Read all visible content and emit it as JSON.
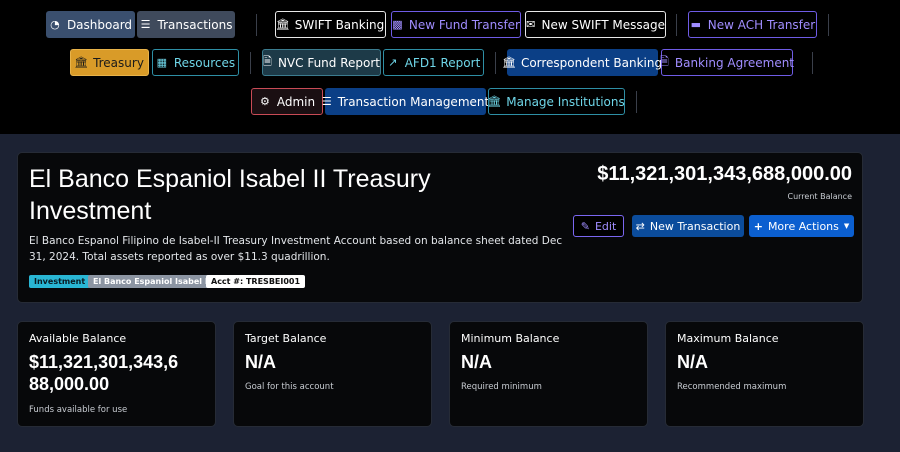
{
  "nav": {
    "row1": [
      {
        "label": "Dashboard",
        "icon": "dashboard-icon"
      },
      {
        "label": "Transactions",
        "icon": "list-icon"
      },
      {
        "label": "SWIFT Banking",
        "icon": "bank-icon"
      },
      {
        "label": "New Fund Transfer",
        "icon": "money-icon"
      },
      {
        "label": "New SWIFT Message",
        "icon": "envelope-icon"
      },
      {
        "label": "New ACH Transfer",
        "icon": "card-icon"
      }
    ],
    "row2": [
      {
        "label": "Treasury",
        "icon": "bank-icon"
      },
      {
        "label": "Resources",
        "icon": "book-icon"
      },
      {
        "label": "NVC Fund Report",
        "icon": "file-icon"
      },
      {
        "label": "AFD1 Report",
        "icon": "chart-icon"
      },
      {
        "label": "Correspondent Banking",
        "icon": "bank-icon"
      },
      {
        "label": "Banking Agreement",
        "icon": "file-icon"
      }
    ],
    "row3": [
      {
        "label": "Admin",
        "icon": "user-gear-icon"
      },
      {
        "label": "Transaction Management",
        "icon": "list-check-icon"
      },
      {
        "label": "Manage Institutions",
        "icon": "bank-icon"
      }
    ]
  },
  "account": {
    "title": "El Banco Espaniol Isabel II Treasury Investment",
    "description": "El Banco Espanol Filipino de Isabel-II Treasury Investment Account based on balance sheet dated Dec 31, 2024. Total assets reported as over $11.3 quadrillion.",
    "badges": {
      "type": "Investment",
      "institution": "El Banco Espaniol Isabel II",
      "account_number": "Acct #: TRESBEI001"
    },
    "current_balance": "$11,321,301,343,688,000.00",
    "current_balance_label": "Current Balance"
  },
  "actions": {
    "edit": "Edit",
    "new_transaction": "New Transaction",
    "more_actions": "More Actions"
  },
  "stats": [
    {
      "label": "Available Balance",
      "value": "$11,321,301,343,6 88,000.00",
      "value_line1": "$11,321,301,343,6",
      "value_line2": "88,000.00",
      "sub": "Funds available for use"
    },
    {
      "label": "Target Balance",
      "value": "N/A",
      "sub": "Goal for this account"
    },
    {
      "label": "Minimum Balance",
      "value": "N/A",
      "sub": "Required minimum"
    },
    {
      "label": "Maximum Balance",
      "value": "N/A",
      "sub": "Recommended maximum"
    }
  ],
  "colors": {
    "nav_bg": "#000000",
    "page_bg": "#1c2233",
    "card_bg": "#07080a",
    "accent_purple": "#6f5ce6",
    "accent_teal": "#2e8fa5",
    "accent_gold": "#d99b28",
    "accent_blue": "#0b5fd0",
    "badge_cyan": "#29b6d4"
  }
}
